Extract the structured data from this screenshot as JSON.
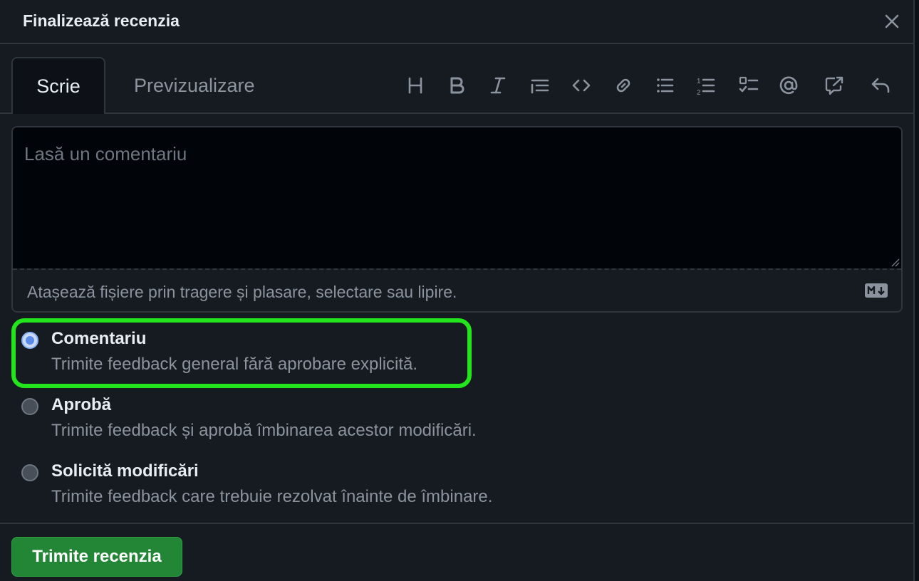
{
  "dialog": {
    "title": "Finalizează recenzia",
    "close_icon": "close-icon"
  },
  "tabs": {
    "write": "Scrie",
    "preview": "Previzualizare"
  },
  "toolbar": {
    "tools": [
      "heading-icon",
      "bold-icon",
      "italic-icon",
      "quote-icon",
      "code-icon",
      "link-icon",
      "unordered-list-icon",
      "ordered-list-icon",
      "task-list-icon",
      "mention-icon",
      "cross-reference-icon",
      "reply-icon"
    ]
  },
  "editor": {
    "placeholder": "Lasă un comentariu",
    "value": "",
    "attach_text": "Atașează fișiere prin tragere și plasare, selectare sau lipire.",
    "markdown_icon": "markdown-icon"
  },
  "options": [
    {
      "title": "Comentariu",
      "description": "Trimite feedback general fără aprobare explicită.",
      "selected": true
    },
    {
      "title": "Aprobă",
      "description": "Trimite feedback și aprobă îmbinarea acestor modificări.",
      "selected": false
    },
    {
      "title": "Solicită modificări",
      "description": "Trimite feedback care trebuie rezolvat înainte de îmbinare.",
      "selected": false
    }
  ],
  "footer": {
    "submit_label": "Trimite recenzia"
  },
  "colors": {
    "background": "#161b22",
    "editor_background": "#010409",
    "border": "#30363d",
    "submit_green": "#238636",
    "highlight_green": "#22e51c"
  }
}
